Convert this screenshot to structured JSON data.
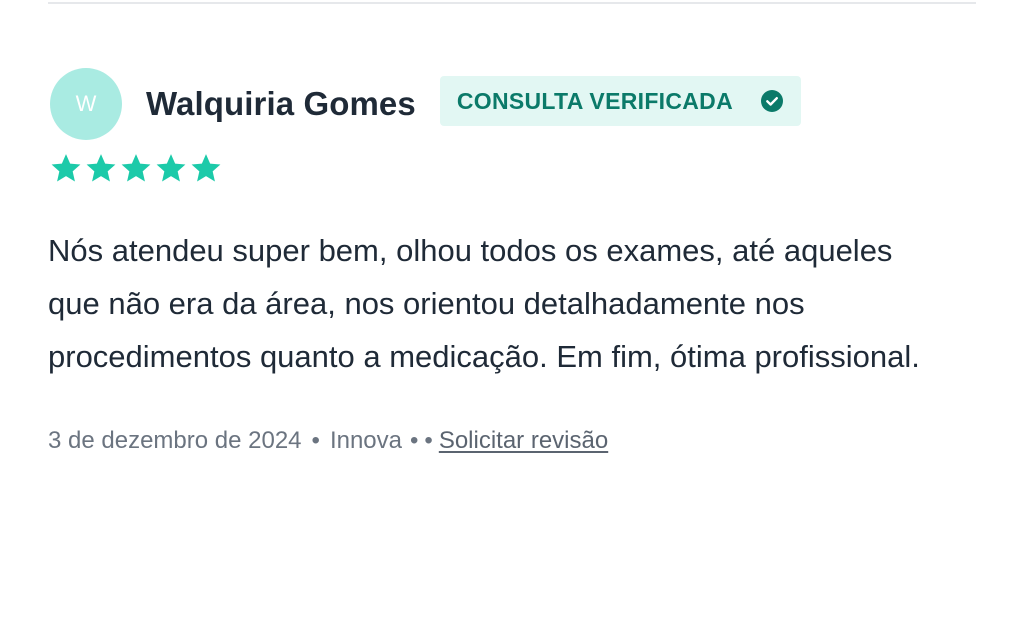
{
  "review": {
    "avatar_initial": "W",
    "reviewer_name": "Walquiria Gomes",
    "badge_label": "CONSULTA VERIFICADA",
    "rating": 5,
    "rating_max": 5,
    "text": "Nós atendeu super bem, olhou todos os exames, até aqueles que não era da área, nos orientou detalhadamente nos procedimentos quanto a medicação. Em fim, ótima profissional.",
    "date": "3 de dezembro de 2024",
    "location": "Innova",
    "separator": "•",
    "request_review_label": "Solicitar revisão"
  },
  "colors": {
    "accent": "#1ccaa9",
    "badge_bg": "#e2f7f3",
    "badge_text": "#0b7a69",
    "avatar_bg": "#a9ebe2",
    "text": "#1f2a37",
    "muted": "#6b7480"
  },
  "icons": {
    "verified": "check-circle-icon",
    "star": "star-icon"
  }
}
